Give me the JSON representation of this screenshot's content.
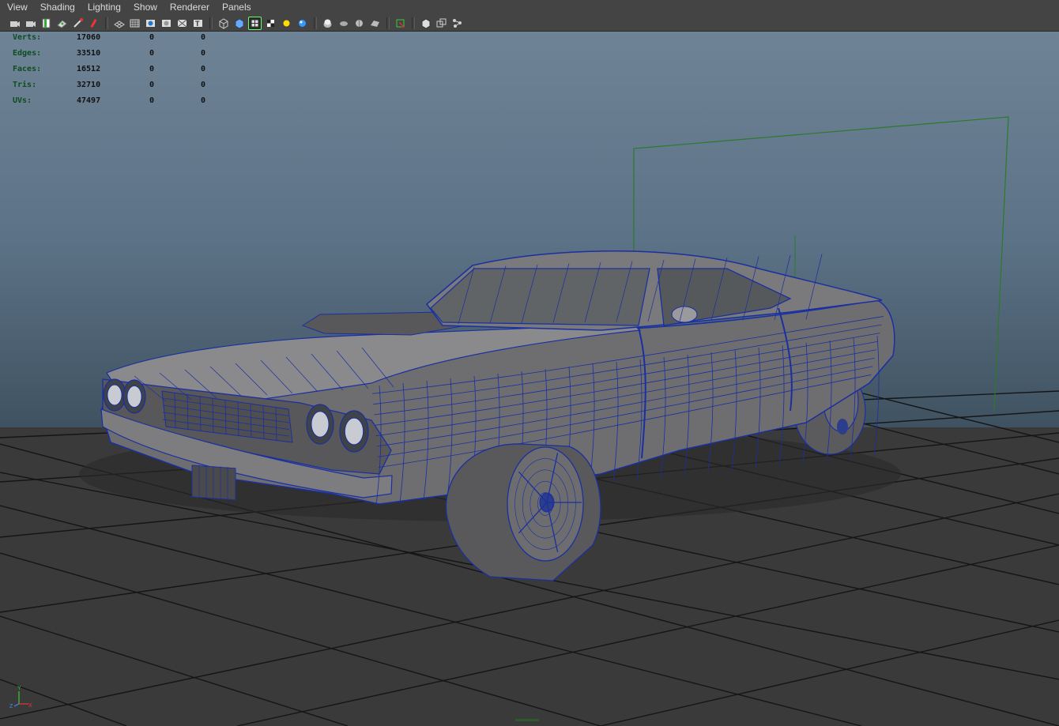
{
  "menu": {
    "items": [
      "View",
      "Shading",
      "Lighting",
      "Show",
      "Renderer",
      "Panels"
    ]
  },
  "toolbar": {
    "groups": [
      [
        "camera-select-icon",
        "camera-attributes-icon",
        "bookmark-icon",
        "image-plane-icon",
        "grease-pencil-icon",
        "isolate-icon"
      ],
      [
        "grid-icon",
        "film-gate-icon",
        "resolution-gate-icon",
        "gate-mask-icon",
        "field-chart-icon",
        "safe-title-icon"
      ],
      [
        "wireframe-icon",
        "smooth-shade-icon",
        "wireframe-on-shaded-icon",
        "textured-icon",
        "use-all-lights-icon",
        "shadows-icon"
      ],
      [
        "screen-space-ambient-occlusion-icon",
        "motion-blur-icon",
        "anti-aliasing-icon",
        "depth-of-field-icon"
      ],
      [
        "xray-icon"
      ],
      [
        "backface-culling-icon",
        "xray-joints-icon",
        "xray-components-icon"
      ]
    ],
    "active": "wireframe-on-shaded-icon"
  },
  "hud": {
    "rows": [
      {
        "label": "Verts:",
        "v1": "17060",
        "v2": "0",
        "v3": "0"
      },
      {
        "label": "Edges:",
        "v1": "33510",
        "v2": "0",
        "v3": "0"
      },
      {
        "label": "Faces:",
        "v1": "16512",
        "v2": "0",
        "v3": "0"
      },
      {
        "label": "Tris:",
        "v1": "32710",
        "v2": "0",
        "v3": "0"
      },
      {
        "label": "UVs:",
        "v1": "47497",
        "v2": "0",
        "v3": "0"
      }
    ]
  },
  "axis": {
    "x": "X",
    "y": "Y",
    "z": "Z"
  },
  "colors": {
    "wire": "#1a2fa0",
    "grid": "#151515",
    "hud_label": "#0b4d1f",
    "selection": "#2b7a2b"
  }
}
